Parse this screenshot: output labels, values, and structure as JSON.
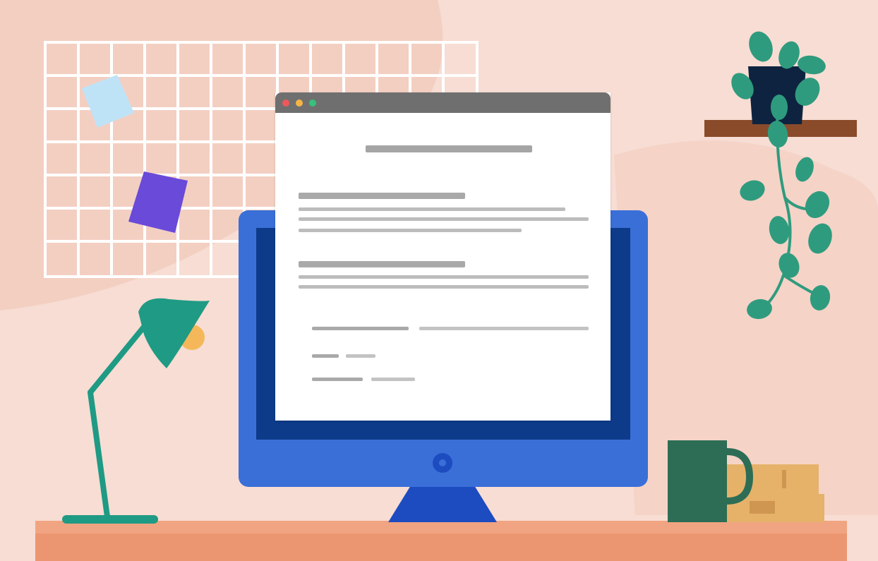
{
  "scene": {
    "description_tag": "illustration",
    "colors": {
      "wall": "#f7ddd3",
      "wall_shape": "#f3cfc2",
      "desk": "#ec9671",
      "desk_top": "#f1a481",
      "monitor_frame": "#3a6fd8",
      "monitor_screen": "#0d3b8a",
      "monitor_stand": "#1d4cc0",
      "lamp": "#1f9a84",
      "lamp_bulb": "#f4b85a",
      "mug": "#2d6d55",
      "books": "#e6b26a",
      "shelf": "#8a4b2a",
      "plant_pot": "#0e2340",
      "plant_leaves": "#2f9b7e",
      "grid_board": "#ffffff",
      "sticky_note_blue": "#bfe3f6",
      "sticky_note_purple": "#6a4ad8"
    },
    "browser": {
      "dots": [
        "#f0575b",
        "#f5b544",
        "#36c07a"
      ],
      "titlebar_color": "#6f6f6f"
    }
  }
}
